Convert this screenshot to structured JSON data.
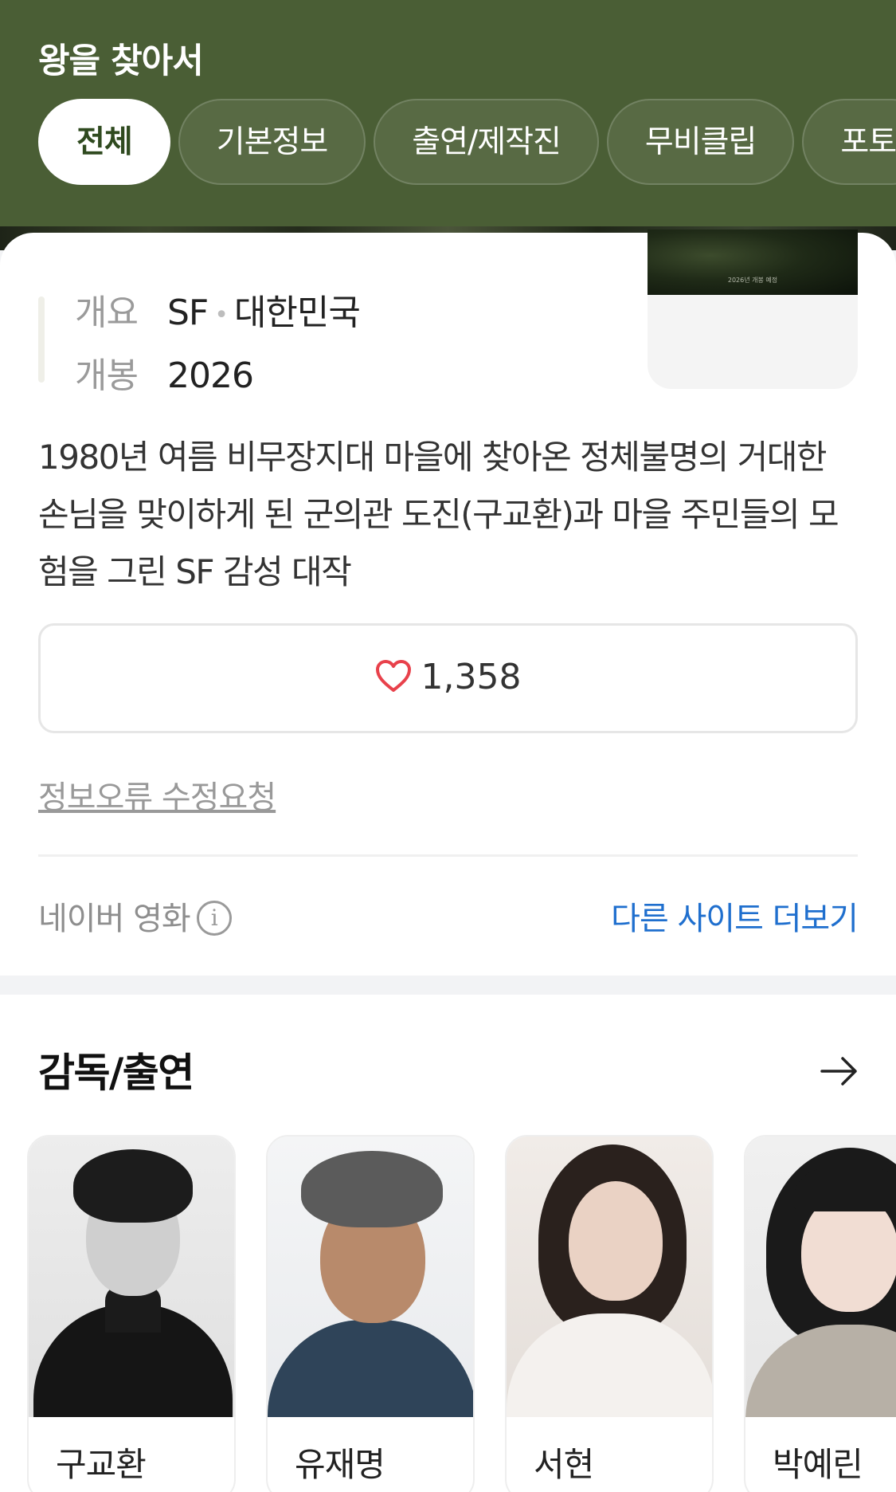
{
  "header": {
    "title": "왕을 찾아서",
    "tabs": [
      {
        "label": "전체",
        "active": true
      },
      {
        "label": "기본정보",
        "active": false
      },
      {
        "label": "출연/제작진",
        "active": false
      },
      {
        "label": "무비클립",
        "active": false
      },
      {
        "label": "포토",
        "active": false
      }
    ]
  },
  "info": {
    "overview_label": "개요",
    "genre": "SF",
    "country": "대한민국",
    "release_label": "개봉",
    "release_year": "2026",
    "poster_caption": "2026년 개봉 예정"
  },
  "synopsis": "1980년 여름 비무장지대 마을에 찾아온 정체불명의 거대한 손님을 맞이하게 된 군의관 도진(구교환)과 마을 주민들의 모험을 그린 SF 감성 대작",
  "like": {
    "count": "1,358",
    "icon": "heart-icon"
  },
  "report_link": "정보오류 수정요청",
  "source": {
    "name": "네이버 영화",
    "more_label": "다른 사이트 더보기"
  },
  "cast": {
    "title": "감독/출연",
    "members": [
      {
        "name": "구교환"
      },
      {
        "name": "유재명"
      },
      {
        "name": "서현"
      },
      {
        "name": "박예린"
      }
    ]
  },
  "colors": {
    "header_bg": "#4a5e35",
    "link_blue": "#1f6fce",
    "heart_red": "#e8414b"
  }
}
